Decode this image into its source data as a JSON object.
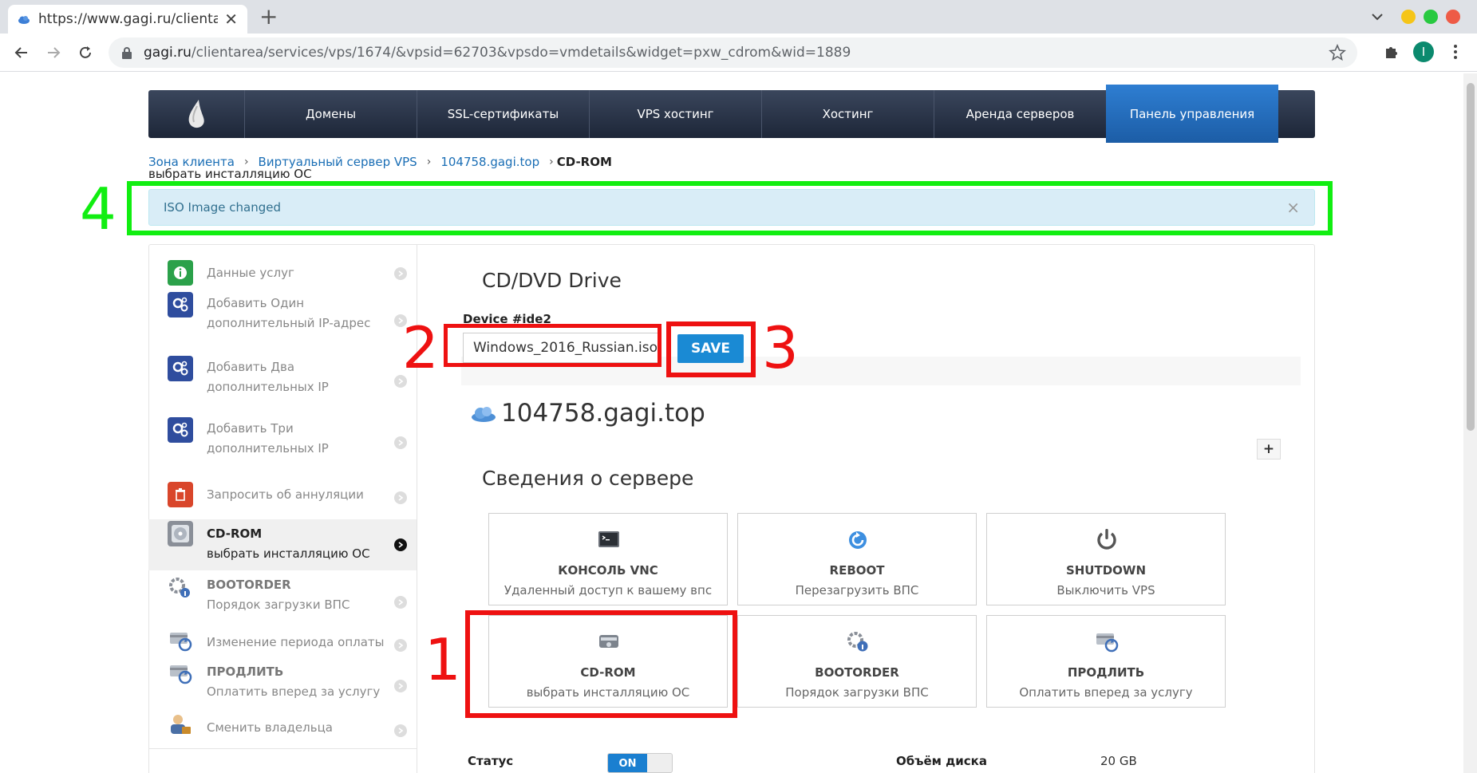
{
  "browser": {
    "tab_title": "https://www.gagi.ru/clientarea/",
    "tab_close": "✕",
    "new_tab": "+",
    "url_host": "gagi.ru",
    "url_path": "/clientarea/services/vps/1674/&vpsid=62703&vpsdo=vmdetails&widget=pxw_cdrom&wid=1889",
    "profile_initial": "I",
    "window_dots": [
      "#f5c518",
      "#28c940",
      "#ee5b46"
    ]
  },
  "topnav": {
    "items": [
      "Домены",
      "SSL-сертификаты",
      "VPS хостинг",
      "Хостинг",
      "Аренда серверов",
      "Панель управления"
    ],
    "active_index": 5
  },
  "breadcrumb": {
    "items": [
      "Зона клиента",
      "Виртуальный сервер VPS",
      "104758.gagi.top"
    ],
    "current": "CD-ROM",
    "sub": "выбрать инсталляцию ОС"
  },
  "alert": {
    "text": "ISO Image changed",
    "close": "×"
  },
  "sidebar": {
    "items": [
      {
        "line1": "Данные услуг",
        "line2": "",
        "icon": "info-icon",
        "color": "#2ba14a"
      },
      {
        "line1": "Добавить Один",
        "line2": "дополнительный IP-адрес",
        "icon": "gears-icon",
        "color": "#2f4d9e"
      },
      {
        "line1": "Добавить Два",
        "line2": "дополнительных IP",
        "icon": "gears-icon",
        "color": "#2f4d9e"
      },
      {
        "line1": "Добавить Три",
        "line2": "дополнительных IP",
        "icon": "gears-icon",
        "color": "#2f4d9e"
      },
      {
        "line1": "Запросить об аннуляции",
        "line2": "",
        "icon": "trash-icon",
        "color": "#d9462b"
      },
      {
        "line1": "CD-ROM",
        "line2": "выбрать инсталляцию ОС",
        "icon": "cdrom-icon",
        "color": "#8a8f98"
      },
      {
        "line1": "BOOTORDER",
        "line2": "Порядок загрузки ВПС",
        "icon": "bootorder-icon",
        "color": "#8a8f98"
      },
      {
        "line1": "Изменение периода оплаты",
        "line2": "",
        "icon": "renew-icon",
        "color": "#8a8f98"
      },
      {
        "line1": "ПРОДЛИТЬ",
        "line2": "Оплатить вперед за услугу",
        "icon": "renew-icon",
        "color": "#8a8f98"
      },
      {
        "line1": "Сменить владельца",
        "line2": "",
        "icon": "owner-icon",
        "color": "#c98a2a"
      }
    ]
  },
  "main": {
    "heading": "CD/DVD Drive",
    "device_label": "Device #ide2",
    "iso_value": "Windows_2016_Russian.iso",
    "save_label": "SAVE",
    "hostname": "104758.gagi.top",
    "plus": "+",
    "section_title": "Сведения о сервере",
    "actions": [
      {
        "title": "КОНСОЛЬ VNC",
        "sub": "Удаленный доступ к вашему впс",
        "icon": "console-icon"
      },
      {
        "title": "REBOOT",
        "sub": "Перезагрузить ВПС",
        "icon": "reboot-icon"
      },
      {
        "title": "SHUTDOWN",
        "sub": "Выключить VPS",
        "icon": "power-icon"
      },
      {
        "title": "CD-ROM",
        "sub": "выбрать инсталляцию ОС",
        "icon": "cdrom-icon"
      },
      {
        "title": "BOOTORDER",
        "sub": "Порядок загрузки ВПС",
        "icon": "bootorder-icon"
      },
      {
        "title": "ПРОДЛИТЬ",
        "sub": "Оплатить вперед за услугу",
        "icon": "renew-icon"
      }
    ],
    "status_label": "Статус",
    "status_value": "ON",
    "disk_label": "Объём диска",
    "disk_value": "20 GB"
  },
  "annotations": {
    "labels": [
      "1",
      "2",
      "3",
      "4"
    ],
    "red": "#ee1111",
    "green": "#11ee11"
  }
}
